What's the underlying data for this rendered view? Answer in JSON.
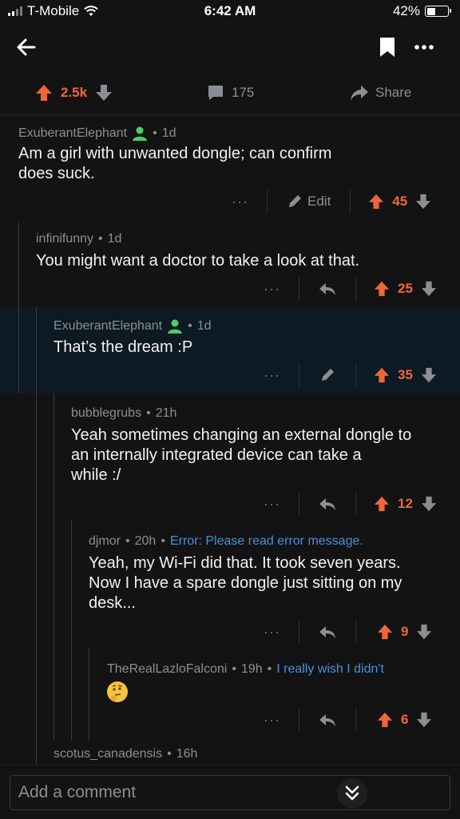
{
  "status_bar": {
    "carrier": "T-Mobile",
    "time": "6:42 AM",
    "battery": "42%",
    "battery_level": 0.42
  },
  "nav": {
    "back_icon": "arrow-left-icon",
    "bookmark_icon": "bookmark-icon",
    "more_icon": "more-horizontal-icon"
  },
  "post_bar": {
    "score": "2.5k",
    "comments": "175",
    "share": "Share"
  },
  "comments": [
    {
      "author": "ExuberantElephant",
      "time": "1d",
      "flair": "",
      "body_lines": [
        "Am a girl with unwanted dongle; can confirm",
        "does suck."
      ],
      "edit": "Edit",
      "score": "45",
      "more": "···"
    },
    {
      "author": "infinifunny",
      "time": "1d",
      "flair": "",
      "body_lines": [
        "You might want a doctor to take a look at that."
      ],
      "score": "25",
      "more": "···"
    },
    {
      "author": "ExuberantElephant",
      "time": "1d",
      "flair": "",
      "body_lines": [
        "That’s the dream :P"
      ],
      "score": "35",
      "more": "···"
    },
    {
      "author": "bubblegrubs",
      "time": "21h",
      "flair": "",
      "body_lines": [
        "Yeah sometimes changing an external dongle to",
        "an internally integrated device can take a",
        "while :/"
      ],
      "score": "12",
      "more": "···"
    },
    {
      "author": "djmor",
      "time": "20h",
      "flair": "Error: Please read error message.",
      "body_lines": [
        "Yeah, my Wi-Fi did that. It took seven years.",
        "Now I have a spare dongle just sitting on my",
        "desk..."
      ],
      "score": "9",
      "more": "···"
    },
    {
      "author": "TheRealLazloFalconi",
      "time": "19h",
      "flair": "I really wish I didn't",
      "body_emoji": "thinking-face-emoji",
      "score": "6",
      "more": "···"
    },
    {
      "author": "scotus_canadensis",
      "time": "16h",
      "flair": ""
    }
  ],
  "separator": "•",
  "composer": {
    "placeholder": "Add a comment"
  },
  "colors": {
    "upvote": "#f0663a",
    "flair": "#4a90d9",
    "mod_badge": "#46d160",
    "highlight": "#0d1a23",
    "background": "#131313"
  }
}
